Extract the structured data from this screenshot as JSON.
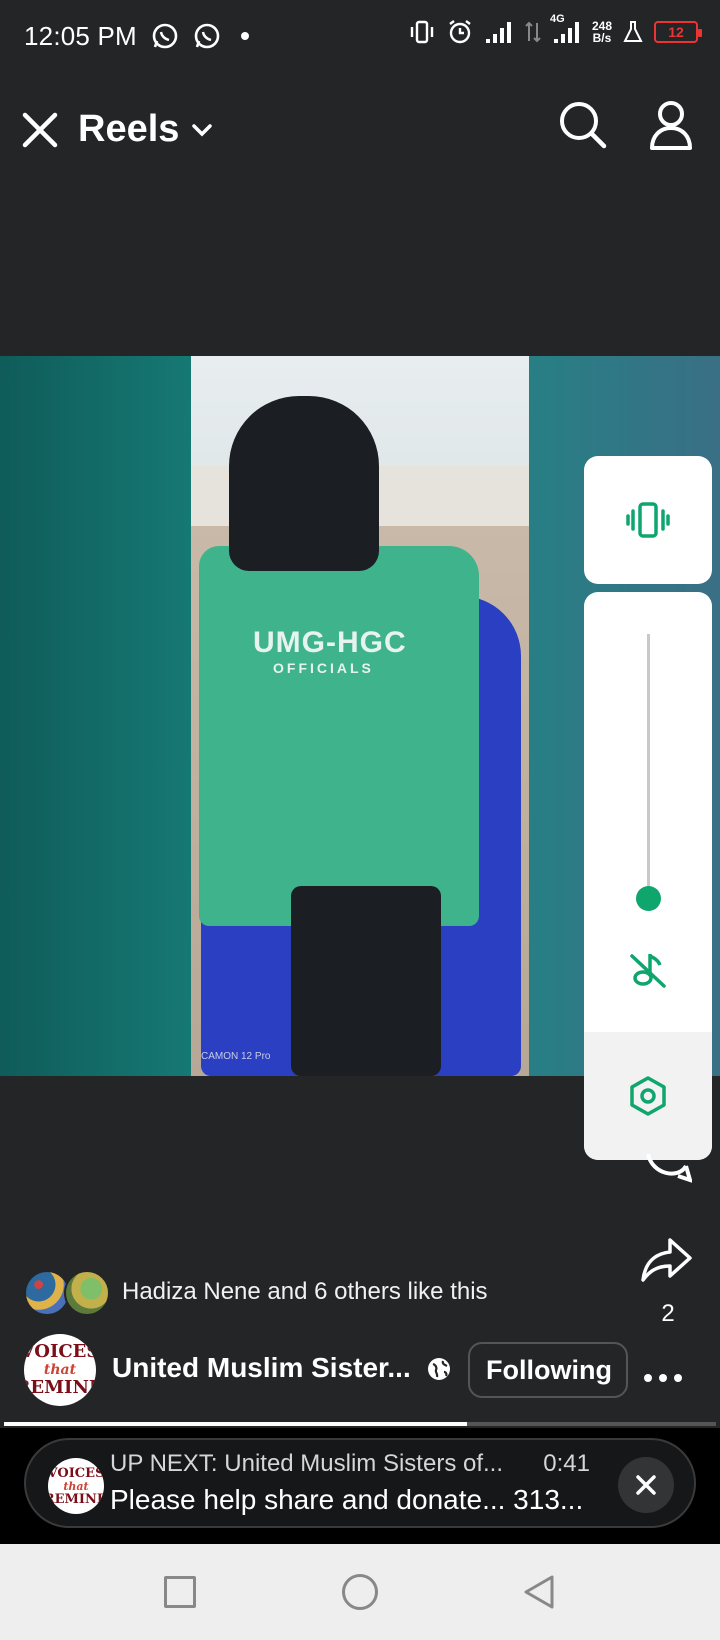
{
  "status_bar": {
    "time": "12:05 PM",
    "net_type": "4G",
    "net_speed_value": "248",
    "net_speed_unit": "B/s",
    "battery": "12",
    "icons": [
      "whatsapp-icon",
      "whatsapp-icon",
      "dot-icon",
      "vibrate-icon",
      "alarm-icon",
      "signal-icon",
      "data-arrows-icon",
      "signal-icon",
      "flask-icon",
      "battery-icon"
    ]
  },
  "header": {
    "title": "Reels",
    "icons": [
      "close-icon",
      "chevron-down-icon",
      "search-icon",
      "profile-icon"
    ]
  },
  "video": {
    "shirt_text": "UMG-HGC",
    "shirt_subtext": "OFFICIALS",
    "camera_stamp": "CAMON 12 Pro"
  },
  "volume_panel": {
    "level": 0.05,
    "icons": [
      "vibrate-icon",
      "mute-icon",
      "settings-icon"
    ],
    "accent": "#0fa66e"
  },
  "actions": {
    "share_count": "2"
  },
  "likes": {
    "text": "Hadiza Nene and 6 others like this"
  },
  "page": {
    "name": "United Muslim Sister...",
    "avatar_text_top": "VOICES",
    "avatar_text_mid": "that",
    "avatar_text_bottom": "REMIND",
    "follow_label": "Following"
  },
  "progress": {
    "value": 0.65
  },
  "up_next": {
    "title": "UP NEXT: United Muslim Sisters of...",
    "duration": "0:41",
    "subtitle": "Please help share and donate... 313...",
    "avatar_text_top": "VOICES",
    "avatar_text_mid": "that",
    "avatar_text_bottom": "REMIND"
  },
  "colors": {
    "background": "#242527",
    "accent_green": "#0fa66e",
    "battery_red": "#e33333"
  }
}
